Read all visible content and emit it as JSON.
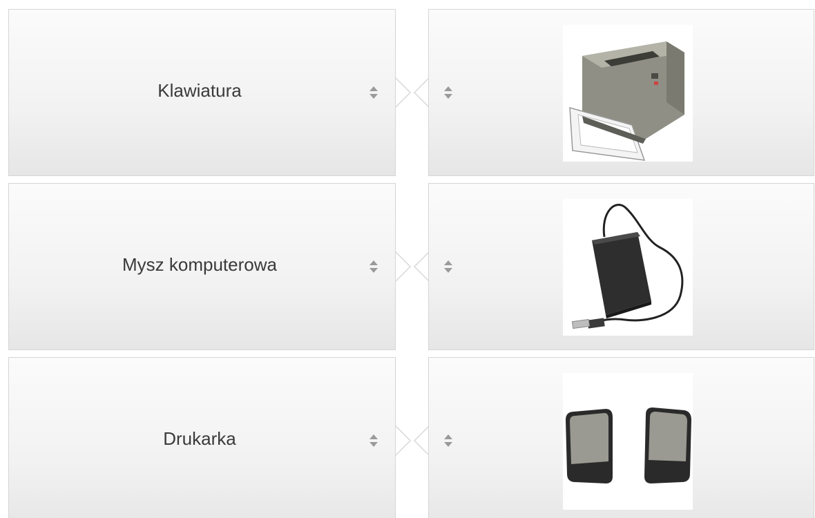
{
  "matching": {
    "pairs": [
      {
        "term": "Klawiatura",
        "image_icon": "printer-image"
      },
      {
        "term": "Mysz komputerowa",
        "image_icon": "external-hard-drive-image"
      },
      {
        "term": "Drukarka",
        "image_icon": "speakers-image"
      }
    ],
    "handle_icon": "sort-updown-icon"
  }
}
